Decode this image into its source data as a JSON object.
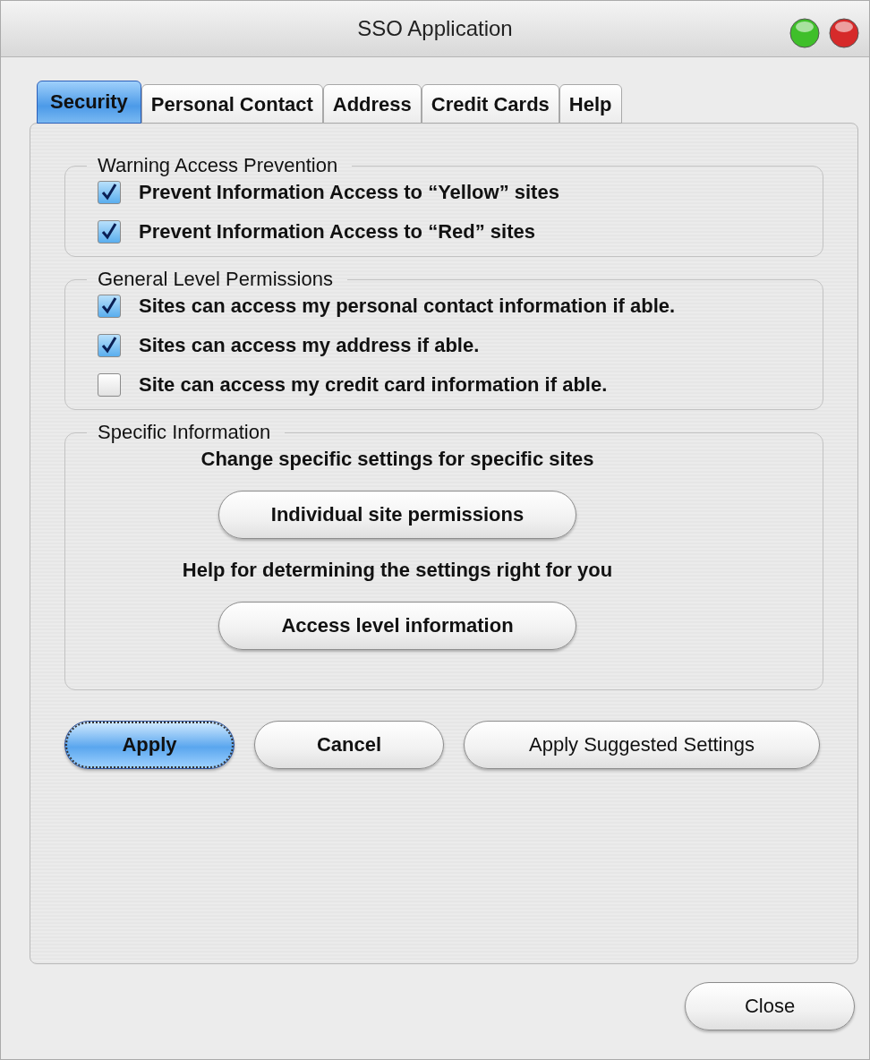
{
  "window": {
    "title": "SSO Application"
  },
  "tabs": [
    {
      "label": "Security",
      "selected": true
    },
    {
      "label": "Personal Contact",
      "selected": false
    },
    {
      "label": "Address",
      "selected": false
    },
    {
      "label": "Credit Cards",
      "selected": false
    },
    {
      "label": "Help",
      "selected": false
    }
  ],
  "groups": [
    {
      "title": "Warning Access Prevention",
      "items": [
        {
          "kind": "checkbox",
          "label": "Prevent Information Access to “Yellow” sites",
          "checked": true
        },
        {
          "kind": "checkbox",
          "label": "Prevent Information Access to “Red” sites",
          "checked": true
        }
      ]
    },
    {
      "title": "General Level Permissions",
      "items": [
        {
          "kind": "checkbox",
          "label": "Sites can access my personal contact information if able.",
          "checked": true
        },
        {
          "kind": "checkbox",
          "label": "Sites can access my address if able.",
          "checked": true
        },
        {
          "kind": "checkbox",
          "label": "Site can access my credit card information if able.",
          "checked": false
        }
      ]
    },
    {
      "title": "Specific Information",
      "items": [
        {
          "kind": "caption",
          "label": "Change specific settings for specific sites"
        },
        {
          "kind": "button",
          "label": "Individual site permissions"
        },
        {
          "kind": "caption",
          "label": "Help for determining the settings right for you"
        },
        {
          "kind": "button",
          "label": "Access level information"
        }
      ]
    }
  ],
  "actions": [
    {
      "label": "Apply",
      "default": true
    },
    {
      "label": "Cancel",
      "default": false
    },
    {
      "label": "Apply Suggested Settings",
      "default": false
    }
  ],
  "close_button": {
    "label": "Close"
  }
}
